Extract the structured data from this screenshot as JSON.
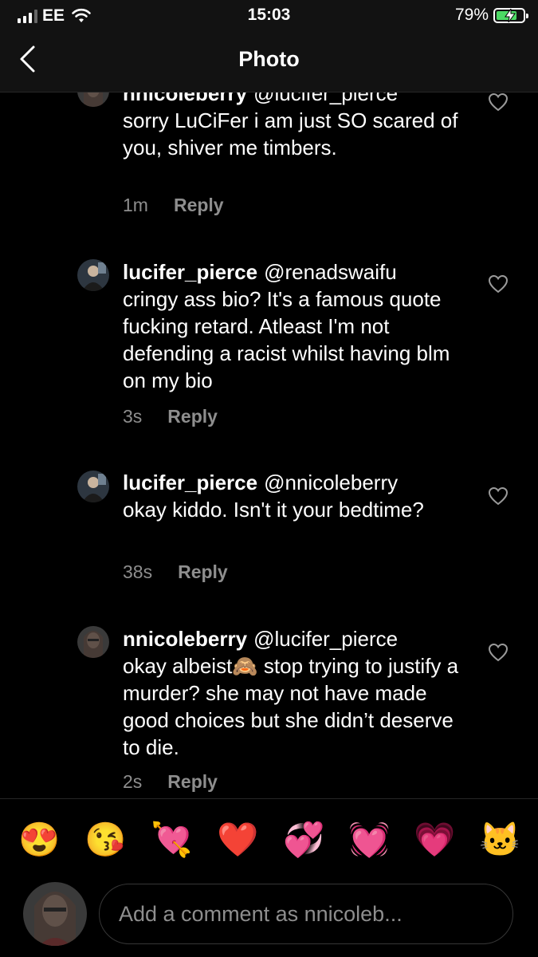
{
  "status_bar": {
    "carrier": "EE",
    "time": "15:03",
    "battery_percent": "79%",
    "battery_level": 0.79,
    "charging": true
  },
  "header": {
    "title": "Photo"
  },
  "comments": [
    {
      "username": "nnicoleberry",
      "mention": "@lucifer_pierce",
      "text": "sorry LuCiFer i am just SO scared of you, shiver me timbers.",
      "time": "1m",
      "reply_label": "Reply"
    },
    {
      "username": "lucifer_pierce",
      "mention": "@renadswaifu",
      "text": "cringy ass bio? It's a famous quote fucking retard. Atleast I'm not defending a racist whilst having blm on my bio",
      "time": "3s",
      "reply_label": "Reply"
    },
    {
      "username": "lucifer_pierce",
      "mention": "@nnicoleberry",
      "text": "okay kiddo. Isn't it your bedtime?",
      "time": "38s",
      "reply_label": "Reply"
    },
    {
      "username": "nnicoleberry",
      "mention": "@lucifer_pierce",
      "text": "okay albeist🙈 stop trying to justify a murder? she may not have made good choices but she didn’t deserve to die.",
      "time": "2s",
      "reply_label": "Reply"
    }
  ],
  "quick_emojis": [
    "😍",
    "😘",
    "💘",
    "❤️",
    "💞",
    "💓",
    "💗",
    "🐱"
  ],
  "comment_input": {
    "placeholder": "Add a comment as nnicoleb..."
  },
  "colors": {
    "background": "#000000",
    "bar_background": "#121212",
    "secondary_text": "#8e8e8e",
    "battery_green": "#4cd964"
  }
}
